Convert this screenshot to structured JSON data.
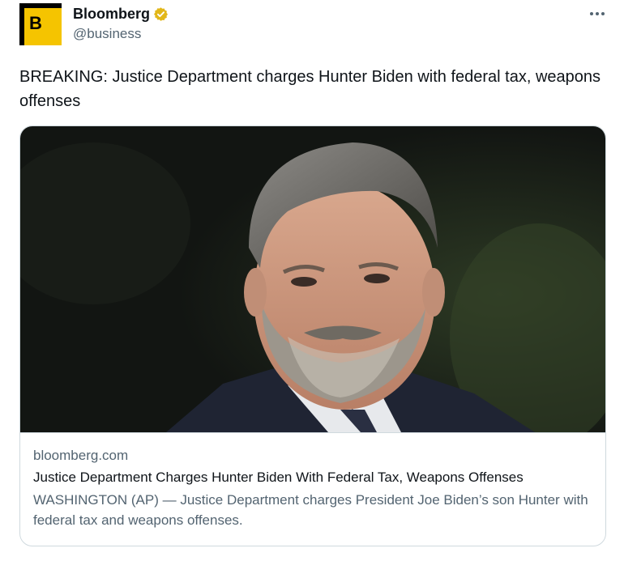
{
  "author": {
    "display_name": "Bloomberg",
    "handle": "@business",
    "avatar_letter": "B",
    "verified_badge": "gold-verified-badge-icon"
  },
  "menu": {
    "icon": "more-horizontal-icon"
  },
  "tweet": {
    "text": "BREAKING: Justice Department charges Hunter Biden with federal tax, weapons offenses"
  },
  "card": {
    "domain": "bloomberg.com",
    "headline": "Justice Department Charges Hunter Biden With Federal Tax, Weapons Offenses",
    "description": "WASHINGTON (AP) — Justice Department charges President Joe Biden’s son Hunter with federal tax and weapons offenses."
  },
  "colors": {
    "text_primary": "#0f1419",
    "text_secondary": "#536471",
    "border": "#cfd9de",
    "brand_yellow": "#f5c400",
    "verified_gold": "#e2b719"
  }
}
